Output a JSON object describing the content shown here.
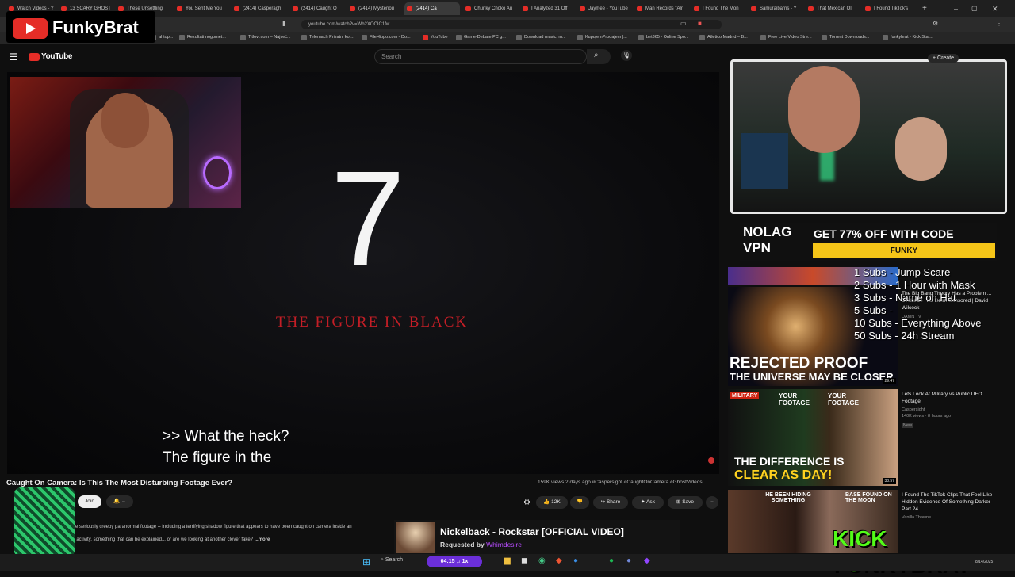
{
  "tabs": [
    "Watch Videos - Y",
    "13 SCARY GHOST",
    "These Unsettling",
    "You Sent Me You",
    "(2414) Casperagh",
    "(2414) Caught O",
    "(2414) Mysteriou",
    "(2414) Ca",
    "Chunky Choko Au",
    "I Analyzed 31 Off",
    "Jaymee - YouTube",
    "Man Records \"Alr",
    "I Found The Mon",
    "Samuraibarris - Y",
    "That Mexican Ol",
    "I Found TikTok's"
  ],
  "url": "youtube.com/watch?v=Wb2XOCIC1fw",
  "bookmarks": [
    "ahtop...",
    "Rezultati nogomet...",
    "Titlovi.com – Najveć...",
    "Telemach Privatni kor...",
    "FileHippo.com - Do...",
    "YouTube",
    "Game-Debate PC g...",
    "Download music, m...",
    "KupujemProdajem |...",
    "bet365 - Online Spo...",
    "Atletico Madrid – B...",
    "Free Live Video Stre...",
    "Torrent Downloads...",
    "funkybrat - Kick Stat..."
  ],
  "brand": {
    "name": "FunkyBrat"
  },
  "youtube": {
    "logo": "YouTube",
    "search_placeholder": "Search",
    "create": "+ Create"
  },
  "video": {
    "big_number": "7",
    "figure_title": "THE FIGURE IN BLACK",
    "caption_line1": ">> What the heck?",
    "caption_line2": "The figure in the",
    "title": "Caught On Camera: Is This The Most Disturbing Footage Ever?",
    "stats": "159K views  2 days ago  #Caspersight #CaughtOnCamera #GhostVideos",
    "join": "Join",
    "likes": "12K",
    "share": "Share",
    "ask": "Ask",
    "save": "Save",
    "desc1": "me seriously creepy paranormal footage -- including a terrifying shadow figure that appears to have been caught on camera inside an",
    "desc2": "al activity, something that can be explained... or are we looking at another clever fake?",
    "more": "...more"
  },
  "vpn": {
    "logo": "NOLAG VPN",
    "offer": "GET 77% OFF WITH CODE",
    "code": "FUNKY"
  },
  "goals": [
    "1 Subs - Jump Scare",
    "2 Subs - 1 Hour with Mask",
    "3 Subs - Name on Hat",
    "5 Subs -",
    "10 Subs - Everything Above",
    "50 Subs - 24h Stream"
  ],
  "recommendations": [
    {
      "title": "The Big Bang Theory Has a Problem ... Evidence Has Been Censored | David Wilcock",
      "channel": "UAMN TV",
      "thumb_text1": "REJECTED PROOF",
      "thumb_text2": "THE UNIVERSE MAY BE CLOSER",
      "duration": "29:47"
    },
    {
      "title": "Lets Look At Military vs Public UFO Footage",
      "channel": "Caspersight",
      "views": "140K views · 8 hours ago",
      "badge": "New",
      "thumb_text1": "THE DIFFERENCE IS",
      "thumb_text2": "CLEAR AS DAY!",
      "duration": "38:57",
      "labels": [
        "MILITARY",
        "YOUR FOOTAGE",
        "YOUR FOOTAGE"
      ]
    },
    {
      "title": "I Found The TikTok Clips That Feel Like Hidden Evidence Of Something Darker Part 24",
      "channel": "Vanilla Thawne",
      "thumb_text1": "HE BEEN HIDING SOMETHING",
      "thumb_text2": "BASE FOUND ON THE MOON"
    }
  ],
  "song": {
    "title": "Nickelback - Rockstar [OFFICIAL VIDEO]",
    "requested_prefix": "Requested by",
    "requester": "Whimdesire"
  },
  "kick": "KICK FUNKYBRAT",
  "taskbar": {
    "search": "Search",
    "time": "04:15",
    "speed": "1x",
    "date": "8/14/2025"
  }
}
